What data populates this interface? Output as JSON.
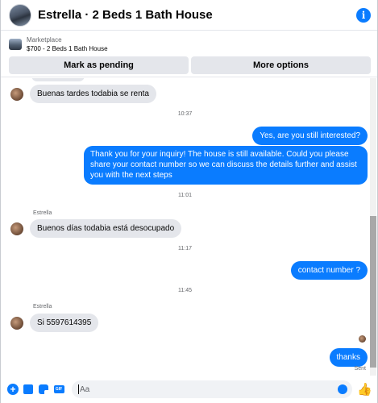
{
  "header": {
    "title": "Estrella · 2 Beds 1 Bath House"
  },
  "listing": {
    "kind": "Marketplace",
    "name": "$700 - 2 Beds 1 Bath House",
    "mark_pending_label": "Mark as pending",
    "more_options_label": "More options"
  },
  "thread": {
    "msg_buenas": "Buenas tardes todabia se renta",
    "time_1": "10:37",
    "msg_still_interested": "Yes, are you still interested?",
    "msg_thank_you": "Thank you for your inquiry! The house is still available. Could you please share your contact number so we can discuss the details further and assist you with the next steps",
    "time_2": "11:01",
    "sender_1": "Estrella",
    "msg_buenos_dias": "Buenos días todabia está desocupado",
    "time_3": "11:17",
    "msg_contact_number": "contact number ?",
    "time_4": "11:45",
    "sender_2": "Estrella",
    "msg_phone": "Si 5597614395",
    "msg_thanks": "thanks",
    "sent_label": "Sent"
  },
  "composer": {
    "placeholder": "Aa"
  },
  "icons": {
    "info": "info-icon",
    "add": "plus-icon",
    "photo": "photo-icon",
    "sticker": "sticker-icon",
    "gif": "gif-icon",
    "emoji": "emoji-icon",
    "like": "thumbs-up-icon"
  },
  "colors": {
    "accent": "#0a7cff",
    "incoming_bubble": "#e4e6eb"
  }
}
